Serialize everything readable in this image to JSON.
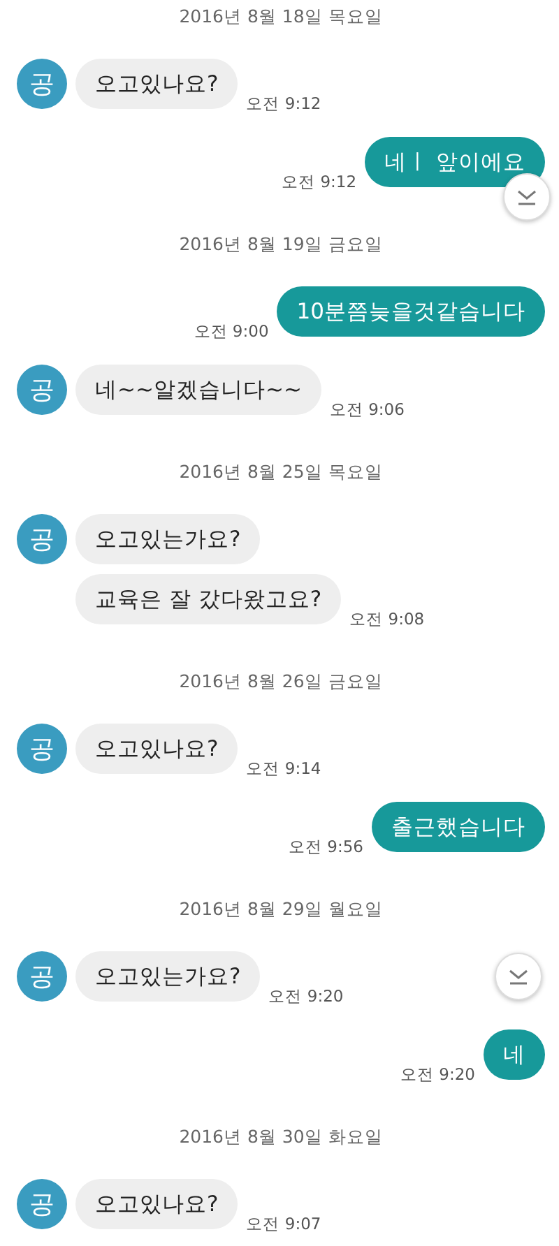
{
  "messages": [
    {
      "kind": "date",
      "text": "2016년 8월 18일 목요일"
    },
    {
      "kind": "received",
      "avatar": "공",
      "text": "오고있나요?",
      "time": "오전 9:12",
      "scroll_button": false
    },
    {
      "kind": "sent",
      "text": "네ㅣ 앞이에요",
      "time": "오전 9:12",
      "scroll_button": true
    },
    {
      "kind": "date",
      "text": "2016년 8월 19일 금요일"
    },
    {
      "kind": "sent",
      "text": "10분쯤늦을것같습니다",
      "time": "오전 9:00",
      "scroll_button": false
    },
    {
      "kind": "received",
      "avatar": "공",
      "text": "네~~알겠습니다~~",
      "time": "오전 9:06",
      "scroll_button": false
    },
    {
      "kind": "date",
      "text": "2016년 8월 25일 목요일"
    },
    {
      "kind": "received",
      "avatar": "공",
      "text": "오고있는가요?",
      "scroll_button": false
    },
    {
      "kind": "received",
      "text": "교육은 잘 갔다왔고요?",
      "time": "오전 9:08",
      "scroll_button": false
    },
    {
      "kind": "date",
      "text": "2016년 8월 26일 금요일"
    },
    {
      "kind": "received",
      "avatar": "공",
      "text": "오고있나요?",
      "time": "오전 9:14",
      "scroll_button": false
    },
    {
      "kind": "sent",
      "text": "출근했습니다",
      "time": "오전 9:56",
      "scroll_button": false
    },
    {
      "kind": "date",
      "text": "2016년 8월 29일 월요일"
    },
    {
      "kind": "received",
      "avatar": "공",
      "text": "오고있는가요?",
      "time": "오전 9:20",
      "scroll_button": true
    },
    {
      "kind": "sent",
      "text": "네",
      "time": "오전 9:20",
      "scroll_button": false
    },
    {
      "kind": "date",
      "text": "2016년 8월 30일 화요일"
    },
    {
      "kind": "received",
      "avatar": "공",
      "text": "오고있나요?",
      "time": "오전 9:07",
      "scroll_button": false
    }
  ]
}
